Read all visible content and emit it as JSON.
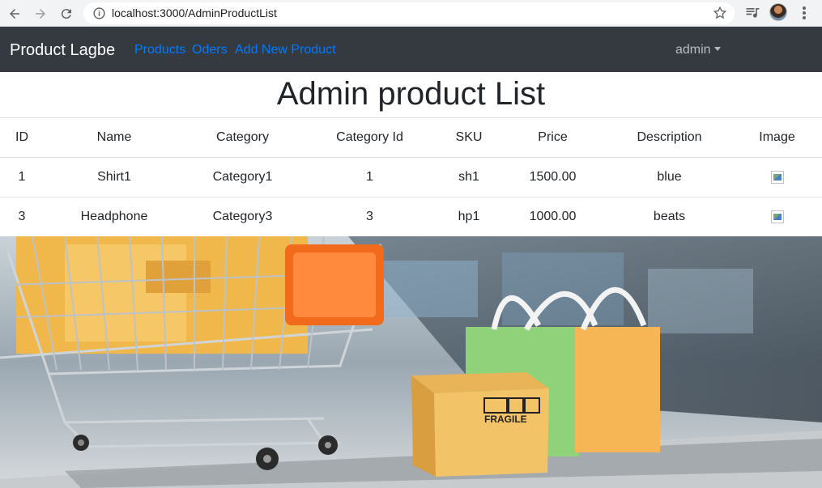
{
  "browser": {
    "url": "localhost:3000/AdminProductList"
  },
  "navbar": {
    "brand": "Product Lagbe",
    "links": [
      "Products",
      "Oders",
      "Add New Product"
    ],
    "user_dropdown": "admin"
  },
  "page": {
    "title": "Admin product List"
  },
  "table": {
    "headers": [
      "ID",
      "Name",
      "Category",
      "Category Id",
      "SKU",
      "Price",
      "Description",
      "Image"
    ],
    "rows": [
      [
        "1",
        "Shirt1",
        "Category1",
        "1",
        "sh1",
        "1500.00",
        "blue"
      ],
      [
        "3",
        "Headphone",
        "Category3",
        "3",
        "hp1",
        "1000.00",
        "beats"
      ]
    ]
  },
  "hero": {
    "box_text": "FRAGILE"
  },
  "colors": {
    "navbar_bg": "#343a40",
    "link": "#007bff",
    "text": "#212529"
  }
}
